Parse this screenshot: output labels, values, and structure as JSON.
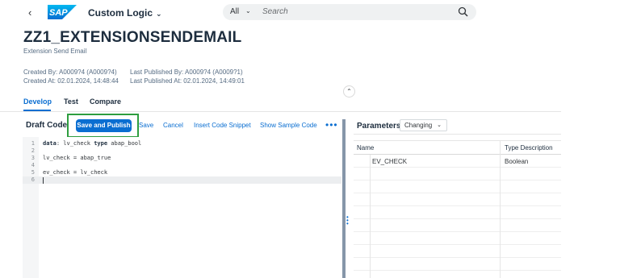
{
  "shell": {
    "back_icon": "chevron-left-icon",
    "logo_text": "SAP",
    "brand_color": "#0a6ed1",
    "app_title": "Custom Logic",
    "search_scope": "All",
    "search_placeholder": "Search"
  },
  "header": {
    "title": "ZZ1_EXTENSIONSENDEMAIL",
    "subtitle": "Extension Send Email",
    "created_by": "Created By: A0009?4 (A0009?4)",
    "created_at": "Created At: 02.01.2024, 14:48:44",
    "published_by": "Last Published By: A0009?4 (A0009?1)",
    "published_at": "Last Published At: 02.01.2024, 14:49:01"
  },
  "tabs": [
    {
      "label": "Develop",
      "active": true
    },
    {
      "label": "Test",
      "active": false
    },
    {
      "label": "Compare",
      "active": false
    }
  ],
  "toolbar": {
    "title": "Draft Code",
    "save_publish": "Save and Publish",
    "save": "Save",
    "cancel": "Cancel",
    "insert_snippet": "Insert Code Snippet",
    "show_sample": "Show Sample Code",
    "overflow": "•••",
    "highlight_color": "#2e9e3f"
  },
  "editor": {
    "lines": [
      {
        "num": "1",
        "text": "data: lv_check type abap_bool"
      },
      {
        "num": "2",
        "text": ""
      },
      {
        "num": "3",
        "text": "lv_check = abap_true"
      },
      {
        "num": "4",
        "text": ""
      },
      {
        "num": "5",
        "text": "ev_check = lv_check"
      },
      {
        "num": "6",
        "text": ""
      }
    ],
    "current_line": 6
  },
  "parameters": {
    "title": "Parameters",
    "filter": "Changing",
    "columns": [
      "Name",
      "Type Description"
    ],
    "rows": [
      {
        "name": "EV_CHECK",
        "type": "Boolean"
      }
    ]
  }
}
